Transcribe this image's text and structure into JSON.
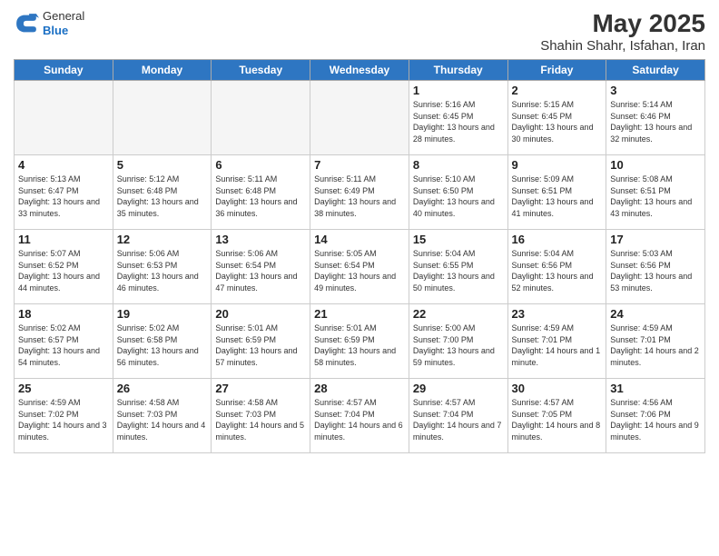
{
  "header": {
    "logo_general": "General",
    "logo_blue": "Blue",
    "main_title": "May 2025",
    "subtitle": "Shahin Shahr, Isfahan, Iran"
  },
  "weekdays": [
    "Sunday",
    "Monday",
    "Tuesday",
    "Wednesday",
    "Thursday",
    "Friday",
    "Saturday"
  ],
  "weeks": [
    [
      {
        "day": "",
        "empty": true
      },
      {
        "day": "",
        "empty": true
      },
      {
        "day": "",
        "empty": true
      },
      {
        "day": "",
        "empty": true
      },
      {
        "day": "1",
        "sunrise": "5:16 AM",
        "sunset": "6:45 PM",
        "daylight": "13 hours and 28 minutes."
      },
      {
        "day": "2",
        "sunrise": "5:15 AM",
        "sunset": "6:45 PM",
        "daylight": "13 hours and 30 minutes."
      },
      {
        "day": "3",
        "sunrise": "5:14 AM",
        "sunset": "6:46 PM",
        "daylight": "13 hours and 32 minutes."
      }
    ],
    [
      {
        "day": "4",
        "sunrise": "5:13 AM",
        "sunset": "6:47 PM",
        "daylight": "13 hours and 33 minutes."
      },
      {
        "day": "5",
        "sunrise": "5:12 AM",
        "sunset": "6:48 PM",
        "daylight": "13 hours and 35 minutes."
      },
      {
        "day": "6",
        "sunrise": "5:11 AM",
        "sunset": "6:48 PM",
        "daylight": "13 hours and 36 minutes."
      },
      {
        "day": "7",
        "sunrise": "5:11 AM",
        "sunset": "6:49 PM",
        "daylight": "13 hours and 38 minutes."
      },
      {
        "day": "8",
        "sunrise": "5:10 AM",
        "sunset": "6:50 PM",
        "daylight": "13 hours and 40 minutes."
      },
      {
        "day": "9",
        "sunrise": "5:09 AM",
        "sunset": "6:51 PM",
        "daylight": "13 hours and 41 minutes."
      },
      {
        "day": "10",
        "sunrise": "5:08 AM",
        "sunset": "6:51 PM",
        "daylight": "13 hours and 43 minutes."
      }
    ],
    [
      {
        "day": "11",
        "sunrise": "5:07 AM",
        "sunset": "6:52 PM",
        "daylight": "13 hours and 44 minutes."
      },
      {
        "day": "12",
        "sunrise": "5:06 AM",
        "sunset": "6:53 PM",
        "daylight": "13 hours and 46 minutes."
      },
      {
        "day": "13",
        "sunrise": "5:06 AM",
        "sunset": "6:54 PM",
        "daylight": "13 hours and 47 minutes."
      },
      {
        "day": "14",
        "sunrise": "5:05 AM",
        "sunset": "6:54 PM",
        "daylight": "13 hours and 49 minutes."
      },
      {
        "day": "15",
        "sunrise": "5:04 AM",
        "sunset": "6:55 PM",
        "daylight": "13 hours and 50 minutes."
      },
      {
        "day": "16",
        "sunrise": "5:04 AM",
        "sunset": "6:56 PM",
        "daylight": "13 hours and 52 minutes."
      },
      {
        "day": "17",
        "sunrise": "5:03 AM",
        "sunset": "6:56 PM",
        "daylight": "13 hours and 53 minutes."
      }
    ],
    [
      {
        "day": "18",
        "sunrise": "5:02 AM",
        "sunset": "6:57 PM",
        "daylight": "13 hours and 54 minutes."
      },
      {
        "day": "19",
        "sunrise": "5:02 AM",
        "sunset": "6:58 PM",
        "daylight": "13 hours and 56 minutes."
      },
      {
        "day": "20",
        "sunrise": "5:01 AM",
        "sunset": "6:59 PM",
        "daylight": "13 hours and 57 minutes."
      },
      {
        "day": "21",
        "sunrise": "5:01 AM",
        "sunset": "6:59 PM",
        "daylight": "13 hours and 58 minutes."
      },
      {
        "day": "22",
        "sunrise": "5:00 AM",
        "sunset": "7:00 PM",
        "daylight": "13 hours and 59 minutes."
      },
      {
        "day": "23",
        "sunrise": "4:59 AM",
        "sunset": "7:01 PM",
        "daylight": "14 hours and 1 minute."
      },
      {
        "day": "24",
        "sunrise": "4:59 AM",
        "sunset": "7:01 PM",
        "daylight": "14 hours and 2 minutes."
      }
    ],
    [
      {
        "day": "25",
        "sunrise": "4:59 AM",
        "sunset": "7:02 PM",
        "daylight": "14 hours and 3 minutes."
      },
      {
        "day": "26",
        "sunrise": "4:58 AM",
        "sunset": "7:03 PM",
        "daylight": "14 hours and 4 minutes."
      },
      {
        "day": "27",
        "sunrise": "4:58 AM",
        "sunset": "7:03 PM",
        "daylight": "14 hours and 5 minutes."
      },
      {
        "day": "28",
        "sunrise": "4:57 AM",
        "sunset": "7:04 PM",
        "daylight": "14 hours and 6 minutes."
      },
      {
        "day": "29",
        "sunrise": "4:57 AM",
        "sunset": "7:04 PM",
        "daylight": "14 hours and 7 minutes."
      },
      {
        "day": "30",
        "sunrise": "4:57 AM",
        "sunset": "7:05 PM",
        "daylight": "14 hours and 8 minutes."
      },
      {
        "day": "31",
        "sunrise": "4:56 AM",
        "sunset": "7:06 PM",
        "daylight": "14 hours and 9 minutes."
      }
    ]
  ]
}
